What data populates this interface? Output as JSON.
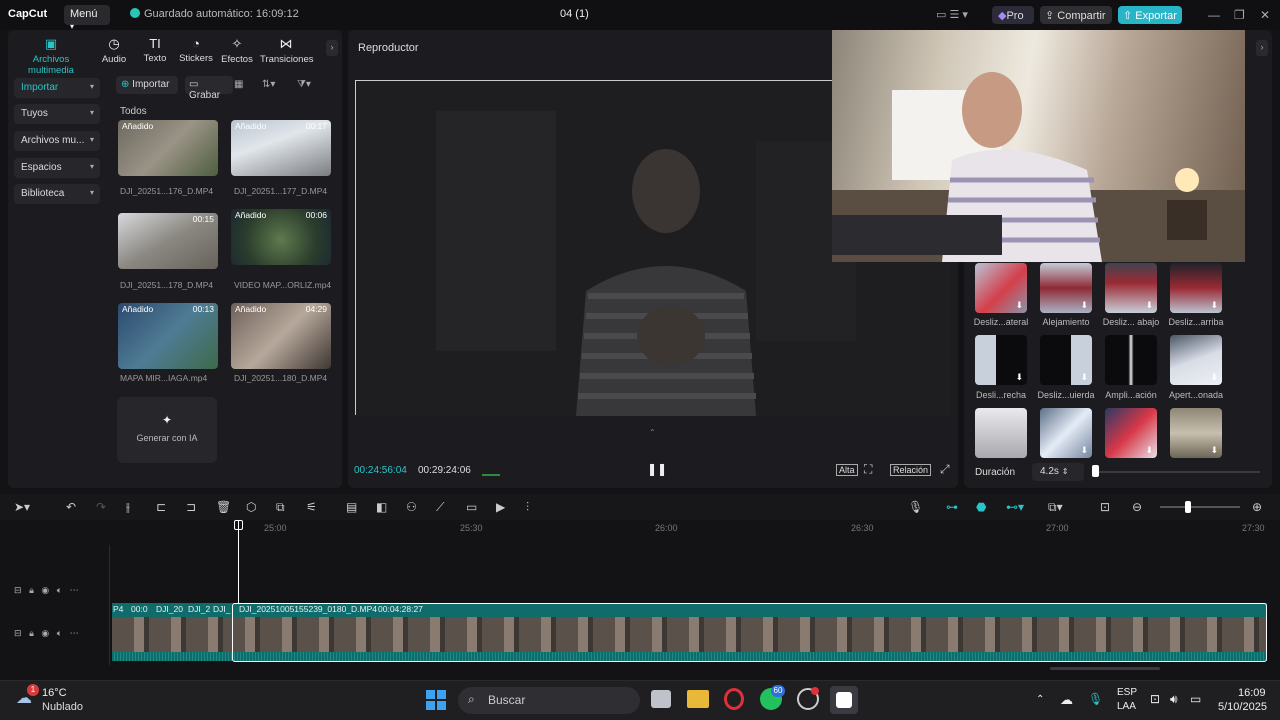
{
  "titlebar": {
    "logo": "CapCut",
    "menu": "Menú",
    "autosave": "Guardado automático: 16:09:12",
    "project": "04 (1)",
    "pro": "Pro",
    "share": "Compartir",
    "export": "Exportar"
  },
  "tabs": [
    {
      "label": "Archivos multimedia",
      "icon": "media-icon"
    },
    {
      "label": "Audio",
      "icon": "audio-icon"
    },
    {
      "label": "Texto",
      "icon": "text-icon"
    },
    {
      "label": "Stickers",
      "icon": "stickers-icon"
    },
    {
      "label": "Efectos",
      "icon": "effects-icon"
    },
    {
      "label": "Transiciones",
      "icon": "transitions-icon"
    }
  ],
  "sidebar": [
    {
      "label": "Importar"
    },
    {
      "label": "Tuyos"
    },
    {
      "label": "Archivos mu..."
    },
    {
      "label": "Espacios"
    },
    {
      "label": "Biblioteca"
    }
  ],
  "media": {
    "import": "Importar",
    "record": "Grabar",
    "all": "Todos",
    "generate": "Generar con IA",
    "items": [
      {
        "name": "DJI_20251...176_D.MP4",
        "badge": "Añadido",
        "duration": ""
      },
      {
        "name": "DJI_20251...177_D.MP4",
        "badge": "Añadido",
        "duration": "00:17"
      },
      {
        "name": "DJI_20251...178_D.MP4",
        "badge": "",
        "duration": "00:15"
      },
      {
        "name": "VIDEO MAP...ORLIZ.mp4",
        "badge": "Añadido",
        "duration": "00:06"
      },
      {
        "name": "MAPA MIR...IAGA.mp4",
        "badge": "Añadido",
        "duration": "00:13"
      },
      {
        "name": "DJI_20251...180_D.MP4",
        "badge": "Añadido",
        "duration": "04:29"
      }
    ]
  },
  "player": {
    "title": "Reproductor",
    "current": "00:24:56:04",
    "total": "00:29:24:06",
    "quality": "Alta",
    "ratio": "Relación"
  },
  "transitions": {
    "items": [
      {
        "label": "Desliz...ateral"
      },
      {
        "label": "Alejamiento"
      },
      {
        "label": "Desliz... abajo"
      },
      {
        "label": "Desliz...arriba"
      },
      {
        "label": "Desli...recha"
      },
      {
        "label": "Desliz...uierda"
      },
      {
        "label": "Ampli...ación"
      },
      {
        "label": "Apert...onada"
      },
      {
        "label": ""
      },
      {
        "label": ""
      },
      {
        "label": ""
      },
      {
        "label": ""
      }
    ],
    "duration_label": "Duración",
    "duration_value": "4.2s"
  },
  "timeline": {
    "ruler": [
      "25:00",
      "25:30",
      "26:00",
      "26:30",
      "27:00",
      "27:30"
    ],
    "clip_labels": [
      "P4",
      "00:0",
      "DJI_20",
      "DJI_2",
      "DJI_"
    ],
    "main_clip": "DJI_20251005155239_0180_D.MP4",
    "main_clip_duration": "00:04:28:27"
  },
  "taskbar": {
    "temp": "16°C",
    "weather": "Nublado",
    "weather_badge": "1",
    "search": "Buscar",
    "whatsapp_badge": "60",
    "lang1": "ESP",
    "lang2": "LAA",
    "time": "16:09",
    "date": "5/10/2025"
  }
}
